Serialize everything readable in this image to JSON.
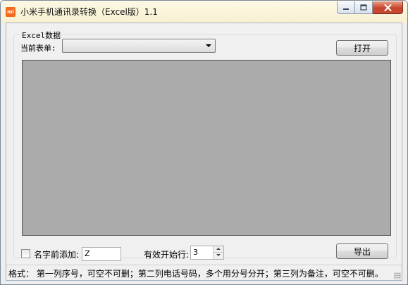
{
  "window": {
    "title": "小米手机通讯录转换（Excel版）1.1",
    "app_icon_text": "mi",
    "app_icon_color": "#f26b1d"
  },
  "group": {
    "legend": "Excel数据"
  },
  "sheet": {
    "label": "当前表单:",
    "selected_value": ""
  },
  "buttons": {
    "open_label": "打开",
    "export_label": "导出"
  },
  "prefix": {
    "checkbox_label": "名字前添加:",
    "checked": false,
    "value": "Z"
  },
  "start_row": {
    "label": "有效开始行:",
    "value": "3"
  },
  "status": {
    "text": "格式： 第一列序号，可空不可删；第二列电话号码，多个用分号分开；第三列为备注，可空不可删。"
  },
  "colors": {
    "grid_background": "#ababab",
    "window_background": "#f0f0f0",
    "close_button": "#c7462c"
  }
}
